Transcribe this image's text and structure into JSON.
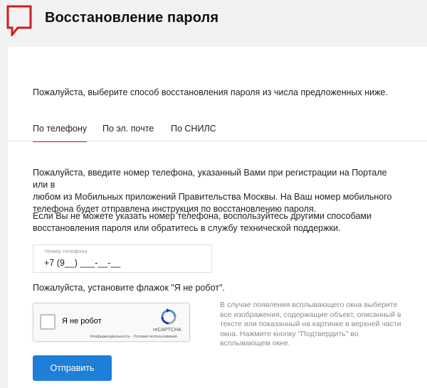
{
  "header": {
    "title": "Восстановление пароля",
    "logo_icon": "mos-speech-bubble-logo",
    "accent_color": "#cc1f1f"
  },
  "intro": "Пожалуйста, выберите способ восстановления пароля из числа предложенных ниже.",
  "tabs": [
    {
      "label": "По телефону",
      "active": true
    },
    {
      "label": "По эл. почте",
      "active": false
    },
    {
      "label": "По СНИЛС",
      "active": false
    }
  ],
  "phone_tab": {
    "paragraph1_line1": "Пожалуйста, введите номер телефона, указанный Вами при регистрации на Портале или в",
    "paragraph1_line2": "любом из Мобильных приложений Правительства Москвы. На Ваш номер мобильного",
    "paragraph1_line3": "телефона будет отправлена инструкция по восстановлению пароля.",
    "paragraph2_line1": "Если Вы не можете указать номер телефона, воспользуйтесь другими способами",
    "paragraph2_line2": "восстановления пароля или обратитесь в службу технической поддержки.",
    "phone_field": {
      "label": "Номер телефона",
      "value": "+7 (9__) ___-__-__"
    },
    "captcha_label": "Пожалуйста, установите флажок \"Я не робот\".",
    "recaptcha": {
      "checkbox_text": "Я не робот",
      "brand": "reCAPTCHA",
      "terms": "Конфиденциальность - Условия использования",
      "icon": "recaptcha-icon"
    },
    "captcha_hint_lines": [
      "В случае появления всплывающего окна выберите",
      "все изображения, содержащие объект, описанный в",
      "тексте или показанный на картинке в верхней части",
      "окна. Нажмите кнопку \"Подтвердить\" во",
      "всплывающем окне."
    ],
    "submit_label": "Отправить",
    "submit_color": "#1e7fd8"
  }
}
